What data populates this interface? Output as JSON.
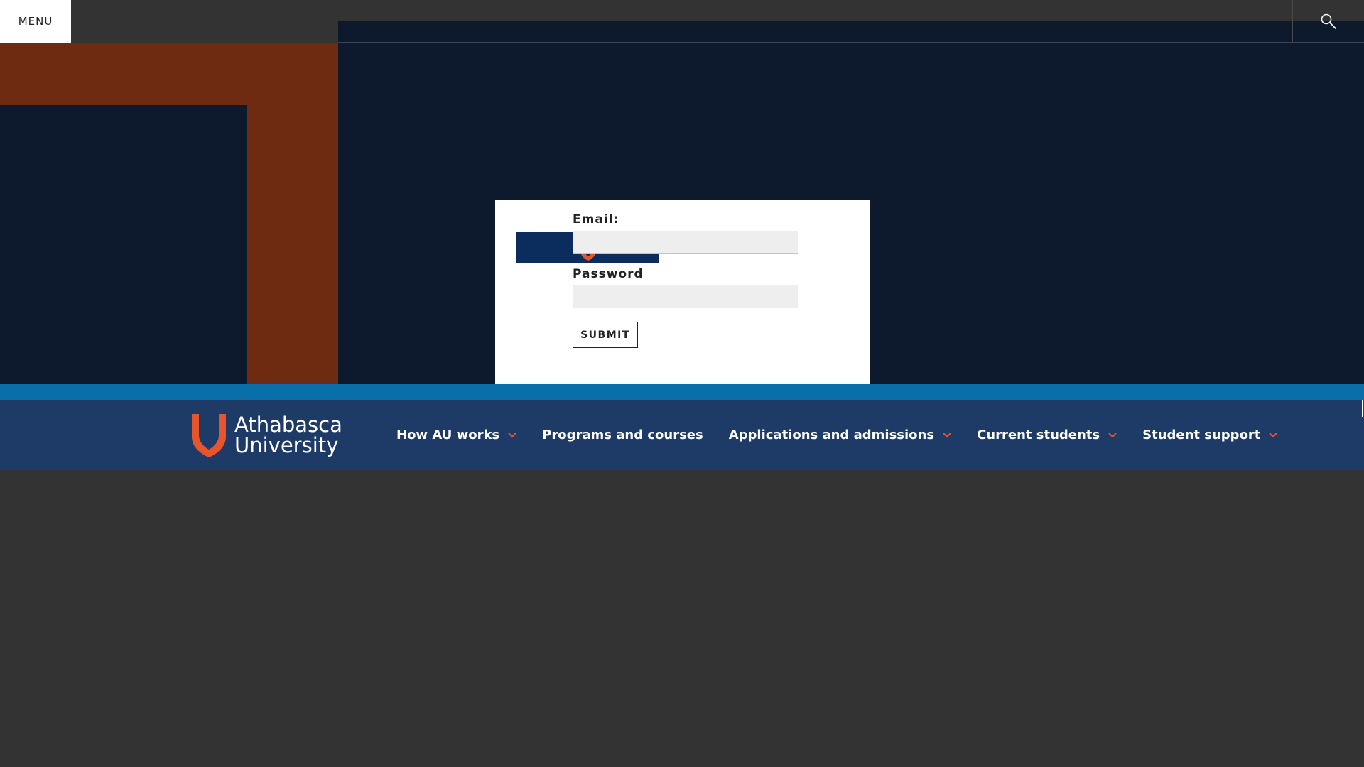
{
  "header": {
    "menu_label": "MENU",
    "search_icon": "search-icon"
  },
  "login": {
    "email_label": "Email:",
    "email_value": "",
    "password_label": "Password",
    "password_value": "",
    "submit_label": "SUBMIT"
  },
  "nav": {
    "logo_line1": "Athabasca",
    "logo_line2": "University",
    "items": [
      {
        "label": "How AU works",
        "has_dropdown": true
      },
      {
        "label": "Programs and courses",
        "has_dropdown": false
      },
      {
        "label": "Applications and admissions",
        "has_dropdown": true
      },
      {
        "label": "Current students",
        "has_dropdown": true
      },
      {
        "label": "Student support",
        "has_dropdown": true
      }
    ]
  },
  "colors": {
    "background": "#333333",
    "hero_navy": "#0d1a2d",
    "rust": "#6e2b12",
    "strip_blue": "#0a6ea8",
    "nav_blue": "#1e3a66",
    "accent_orange": "#e8552a"
  }
}
